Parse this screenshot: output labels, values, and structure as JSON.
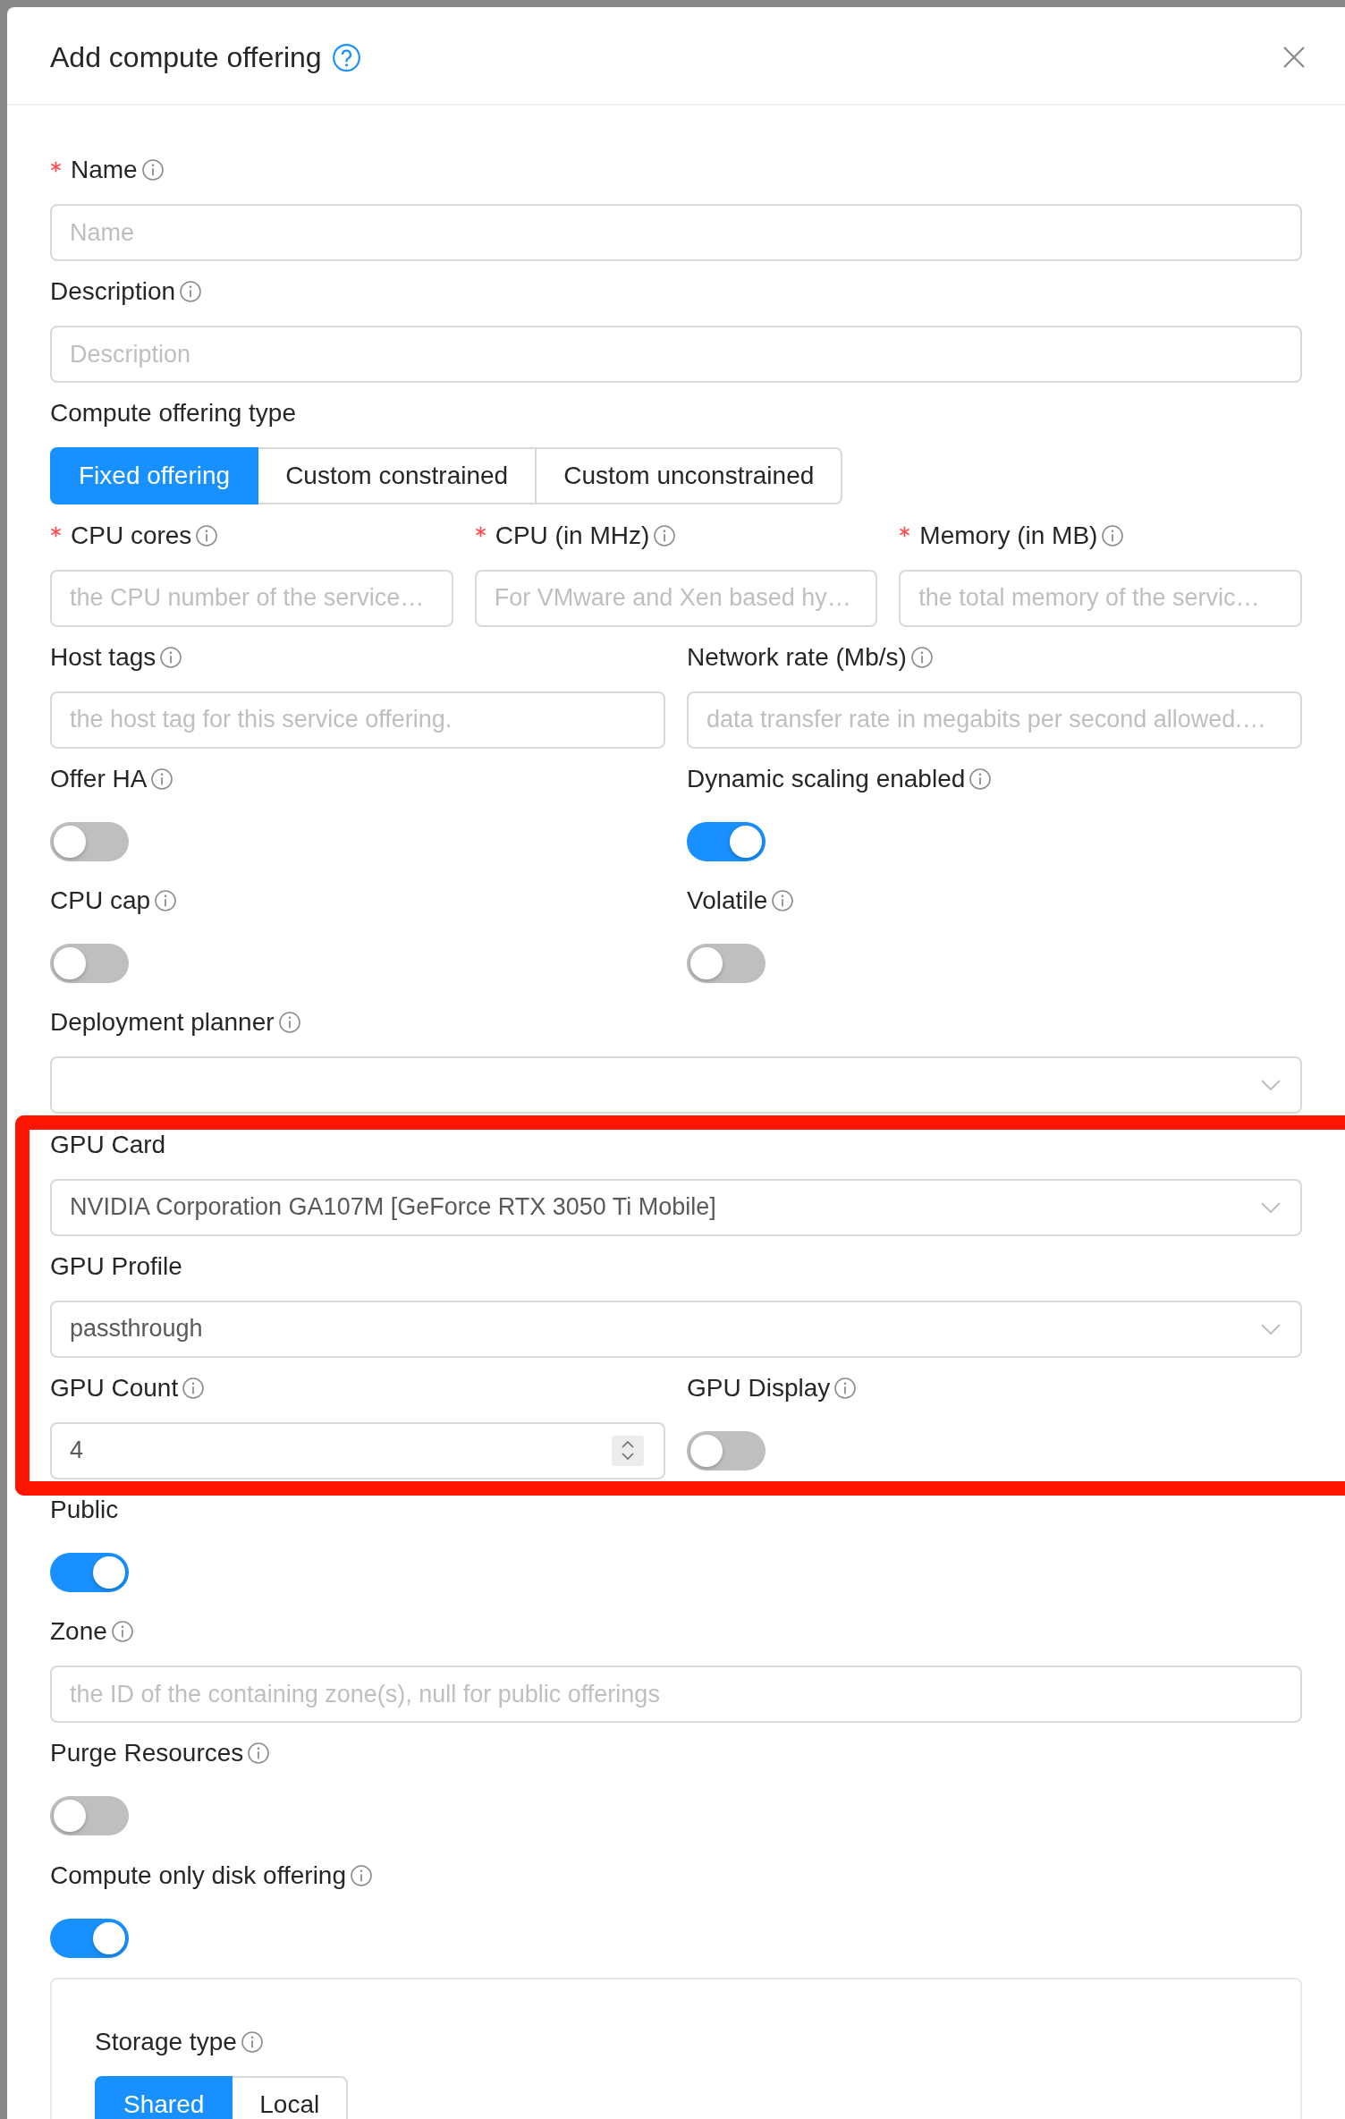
{
  "dialog": {
    "title": "Add compute offering"
  },
  "form": {
    "items": [
      {
        "kind": "input",
        "label": "Name",
        "required": true,
        "info": true,
        "placeholder": "Name"
      },
      {
        "kind": "input",
        "label": "Description",
        "required": false,
        "info": true,
        "placeholder": "Description"
      },
      {
        "kind": "radio",
        "label": "Compute offering type",
        "required": false,
        "info": false,
        "options": [
          {
            "label": "Fixed offering",
            "selected": true
          },
          {
            "label": "Custom constrained",
            "selected": false
          },
          {
            "label": "Custom unconstrained",
            "selected": false
          }
        ]
      },
      {
        "kind": "row",
        "fields": [
          {
            "kind": "input",
            "label": "CPU cores",
            "required": true,
            "info": true,
            "placeholder": "the CPU number of the service…"
          },
          {
            "kind": "input",
            "label": "CPU (in MHz)",
            "required": true,
            "info": true,
            "placeholder": "For VMware and Xen based hy…"
          },
          {
            "kind": "input",
            "label": "Memory (in MB)",
            "required": true,
            "info": true,
            "placeholder": "the total memory of the servic…"
          }
        ]
      },
      {
        "kind": "row",
        "fields": [
          {
            "kind": "input",
            "label": "Host tags",
            "required": false,
            "info": true,
            "placeholder": "the host tag for this service offering."
          },
          {
            "kind": "input",
            "label": "Network rate (Mb/s)",
            "required": false,
            "info": true,
            "placeholder": "data transfer rate in megabits per second allowed.…"
          }
        ]
      },
      {
        "kind": "row",
        "fields": [
          {
            "kind": "switch",
            "label": "Offer HA",
            "required": false,
            "info": true,
            "on": false
          },
          {
            "kind": "switch",
            "label": "Dynamic scaling enabled",
            "required": false,
            "info": true,
            "on": true
          }
        ]
      },
      {
        "kind": "row",
        "fields": [
          {
            "kind": "switch",
            "label": "CPU cap",
            "required": false,
            "info": true,
            "on": false
          },
          {
            "kind": "switch",
            "label": "Volatile",
            "required": false,
            "info": true,
            "on": false
          }
        ]
      },
      {
        "kind": "select",
        "label": "Deployment planner",
        "required": false,
        "info": true
      },
      {
        "kind": "group",
        "highlighted": true,
        "items": [
          {
            "kind": "select",
            "label": "GPU Card",
            "required": false,
            "info": false,
            "value": "NVIDIA Corporation GA107M [GeForce RTX 3050 Ti Mobile]"
          },
          {
            "kind": "select",
            "label": "GPU Profile",
            "required": false,
            "info": false,
            "value": "passthrough"
          },
          {
            "kind": "row",
            "fields": [
              {
                "kind": "number",
                "label": "GPU Count",
                "required": false,
                "info": true,
                "value": "4"
              },
              {
                "kind": "switch",
                "label": "GPU Display",
                "required": false,
                "info": true,
                "on": false
              }
            ]
          }
        ]
      },
      {
        "kind": "switch",
        "label": "Public",
        "required": false,
        "info": false,
        "on": true
      },
      {
        "kind": "input",
        "label": "Zone",
        "required": false,
        "info": true,
        "placeholder": "the ID of the containing zone(s), null for public offerings"
      },
      {
        "kind": "switch",
        "label": "Purge Resources",
        "required": false,
        "info": true,
        "on": false
      },
      {
        "kind": "switch",
        "label": "Compute only disk offering",
        "required": false,
        "info": true,
        "on": true
      },
      {
        "kind": "card",
        "items": [
          {
            "kind": "radio",
            "label": "Storage type",
            "required": false,
            "info": true,
            "options": [
              {
                "label": "Shared",
                "selected": true
              },
              {
                "label": "Local",
                "selected": false
              }
            ]
          }
        ]
      }
    ]
  }
}
